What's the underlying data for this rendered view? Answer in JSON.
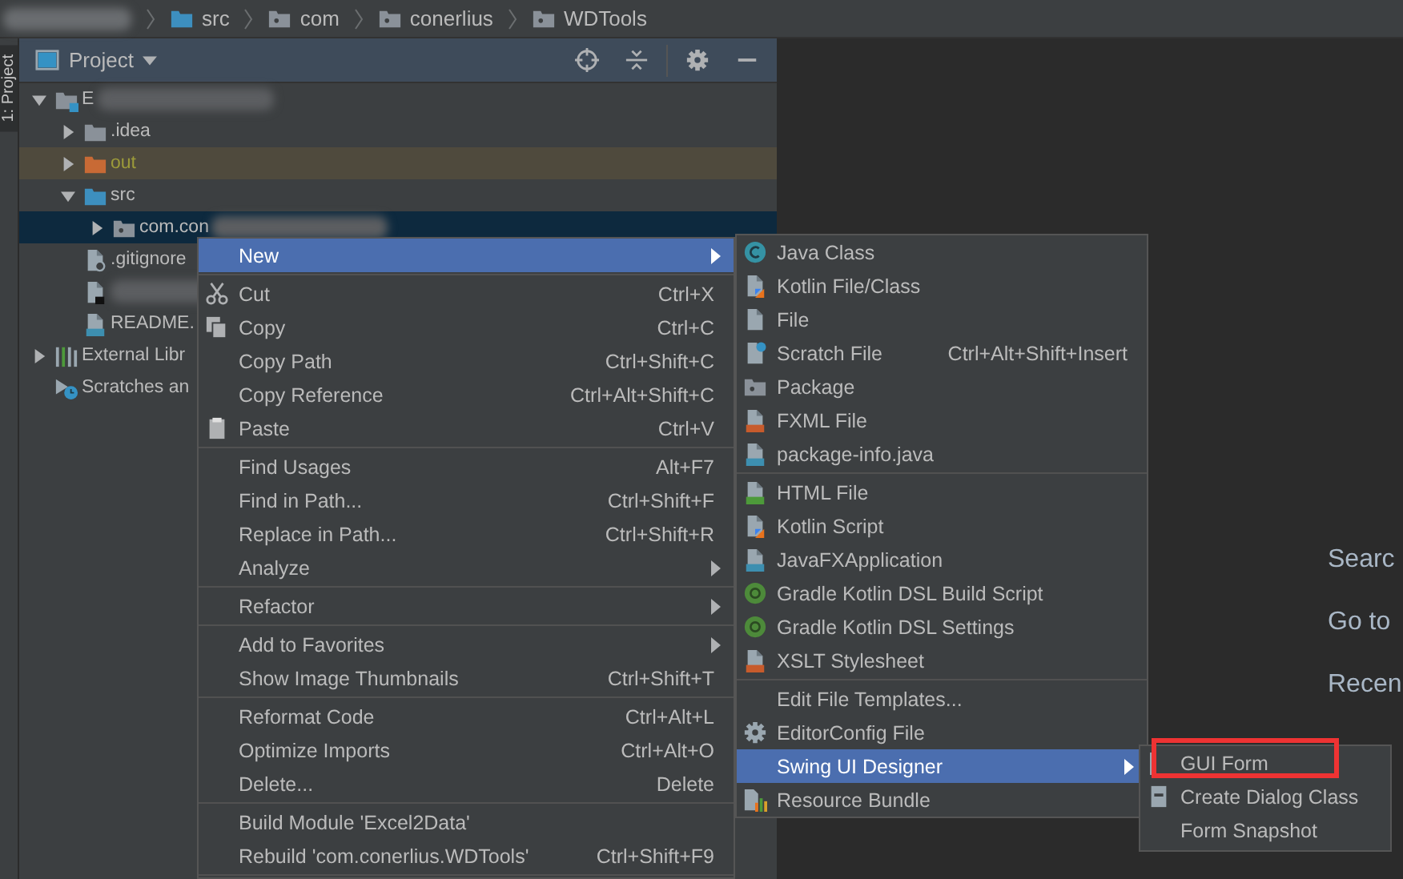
{
  "breadcrumbs": {
    "redacted": true,
    "items": [
      {
        "label": "src",
        "kind": "source"
      },
      {
        "label": "com",
        "kind": "package"
      },
      {
        "label": "conerlius",
        "kind": "package"
      },
      {
        "label": "WDTools",
        "kind": "package"
      }
    ]
  },
  "tool_window": {
    "strip_tab": "1: Project",
    "title": "Project"
  },
  "tree": [
    {
      "label": "E",
      "redacted": true,
      "kind": "module",
      "expanded": true,
      "selected": false,
      "children": [
        {
          "label": ".idea",
          "kind": "folder",
          "expanded": false,
          "selected": false
        },
        {
          "label": "out",
          "kind": "excluded",
          "expanded": false,
          "selected": false
        },
        {
          "label": "src",
          "kind": "source",
          "expanded": true,
          "selected": false,
          "children": [
            {
              "label": "com.con",
              "redacted": true,
              "kind": "package",
              "expanded": false,
              "selected": true
            }
          ]
        },
        {
          "label": ".gitignore",
          "kind": "ignore",
          "selected": false
        },
        {
          "redacted": true,
          "kind": "script",
          "selected": false
        },
        {
          "label": "README.",
          "kind": "markdown",
          "selected": false
        }
      ]
    },
    {
      "label": "External Libr",
      "kind": "libraries",
      "expanded": false,
      "selected": false
    },
    {
      "label": "Scratches an",
      "kind": "scratches",
      "selected": false
    }
  ],
  "context_menu": [
    {
      "kind": "plain",
      "label": "New",
      "submenu": true,
      "selected": true
    },
    {
      "kind": "separator"
    },
    {
      "kind": "cut",
      "label": "Cut",
      "shortcut": "Ctrl+X",
      "submenu": false,
      "selected": false
    },
    {
      "kind": "copy",
      "label": "Copy",
      "shortcut": "Ctrl+C",
      "submenu": false,
      "selected": false
    },
    {
      "kind": "plain",
      "label": "Copy Path",
      "shortcut": "Ctrl+Shift+C",
      "submenu": false,
      "selected": false
    },
    {
      "kind": "plain",
      "label": "Copy Reference",
      "shortcut": "Ctrl+Alt+Shift+C",
      "submenu": false,
      "selected": false
    },
    {
      "kind": "paste",
      "label": "Paste",
      "shortcut": "Ctrl+V",
      "submenu": false,
      "selected": false
    },
    {
      "kind": "separator"
    },
    {
      "kind": "plain",
      "label": "Find Usages",
      "shortcut": "Alt+F7",
      "submenu": false,
      "selected": false
    },
    {
      "kind": "plain",
      "label": "Find in Path...",
      "shortcut": "Ctrl+Shift+F",
      "submenu": false,
      "selected": false
    },
    {
      "kind": "plain",
      "label": "Replace in Path...",
      "shortcut": "Ctrl+Shift+R",
      "submenu": false,
      "selected": false
    },
    {
      "kind": "plain",
      "label": "Analyze",
      "submenu": true,
      "selected": false
    },
    {
      "kind": "separator"
    },
    {
      "kind": "plain",
      "label": "Refactor",
      "submenu": true,
      "selected": false
    },
    {
      "kind": "separator"
    },
    {
      "kind": "plain",
      "label": "Add to Favorites",
      "submenu": true,
      "selected": false
    },
    {
      "kind": "plain",
      "label": "Show Image Thumbnails",
      "shortcut": "Ctrl+Shift+T",
      "submenu": false,
      "selected": false
    },
    {
      "kind": "separator"
    },
    {
      "kind": "plain",
      "label": "Reformat Code",
      "shortcut": "Ctrl+Alt+L",
      "submenu": false,
      "selected": false
    },
    {
      "kind": "plain",
      "label": "Optimize Imports",
      "shortcut": "Ctrl+Alt+O",
      "submenu": false,
      "selected": false
    },
    {
      "kind": "plain",
      "label": "Delete...",
      "shortcut": "Delete",
      "submenu": false,
      "selected": false
    },
    {
      "kind": "separator"
    },
    {
      "kind": "plain",
      "label": "Build Module 'Excel2Data'",
      "submenu": false,
      "selected": false
    },
    {
      "kind": "plain",
      "label": "Rebuild 'com.conerlius.WDTools'",
      "shortcut": "Ctrl+Shift+F9",
      "submenu": false,
      "selected": false
    },
    {
      "kind": "separator"
    }
  ],
  "new_submenu": [
    {
      "kind": "class",
      "label": "Java Class",
      "submenu": false,
      "selected": false
    },
    {
      "kind": "kotlin",
      "label": "Kotlin File/Class",
      "submenu": false,
      "selected": false
    },
    {
      "kind": "file",
      "label": "File",
      "submenu": false,
      "selected": false
    },
    {
      "kind": "scratch",
      "label": "Scratch File",
      "shortcut": "Ctrl+Alt+Shift+Insert",
      "submenu": false,
      "selected": false
    },
    {
      "kind": "package",
      "label": "Package",
      "submenu": false,
      "selected": false
    },
    {
      "kind": "fxml",
      "label": "FXML File",
      "submenu": false,
      "selected": false
    },
    {
      "kind": "java",
      "label": "package-info.java",
      "submenu": false,
      "selected": false
    },
    {
      "kind": "separator"
    },
    {
      "kind": "html",
      "label": "HTML File",
      "submenu": false,
      "selected": false
    },
    {
      "kind": "kotlin",
      "label": "Kotlin Script",
      "submenu": false,
      "selected": false
    },
    {
      "kind": "java",
      "label": "JavaFXApplication",
      "submenu": false,
      "selected": false
    },
    {
      "kind": "gradle",
      "label": "Gradle Kotlin DSL Build Script",
      "submenu": false,
      "selected": false
    },
    {
      "kind": "gradle",
      "label": "Gradle Kotlin DSL Settings",
      "submenu": false,
      "selected": false
    },
    {
      "kind": "fxml",
      "label": "XSLT Stylesheet",
      "submenu": false,
      "selected": false
    },
    {
      "kind": "separator"
    },
    {
      "kind": "plain",
      "label": "Edit File Templates...",
      "submenu": false,
      "selected": false
    },
    {
      "kind": "gear",
      "label": "EditorConfig File",
      "submenu": false,
      "selected": false
    },
    {
      "kind": "plain",
      "label": "Swing UI Designer",
      "submenu": true,
      "selected": true
    },
    {
      "kind": "bundle",
      "label": "Resource Bundle",
      "submenu": false,
      "selected": false
    }
  ],
  "designer_submenu": [
    {
      "kind": "bar",
      "label": "GUI Form",
      "submenu": false,
      "selected": false,
      "marked": true
    },
    {
      "kind": "dialog",
      "label": "Create Dialog Class",
      "submenu": false,
      "selected": false,
      "marked": false
    },
    {
      "kind": "plain",
      "label": "Form Snapshot",
      "submenu": false,
      "selected": false,
      "marked": false
    }
  ],
  "welcome_hints": [
    "Searc",
    "Go to",
    "Recen"
  ]
}
